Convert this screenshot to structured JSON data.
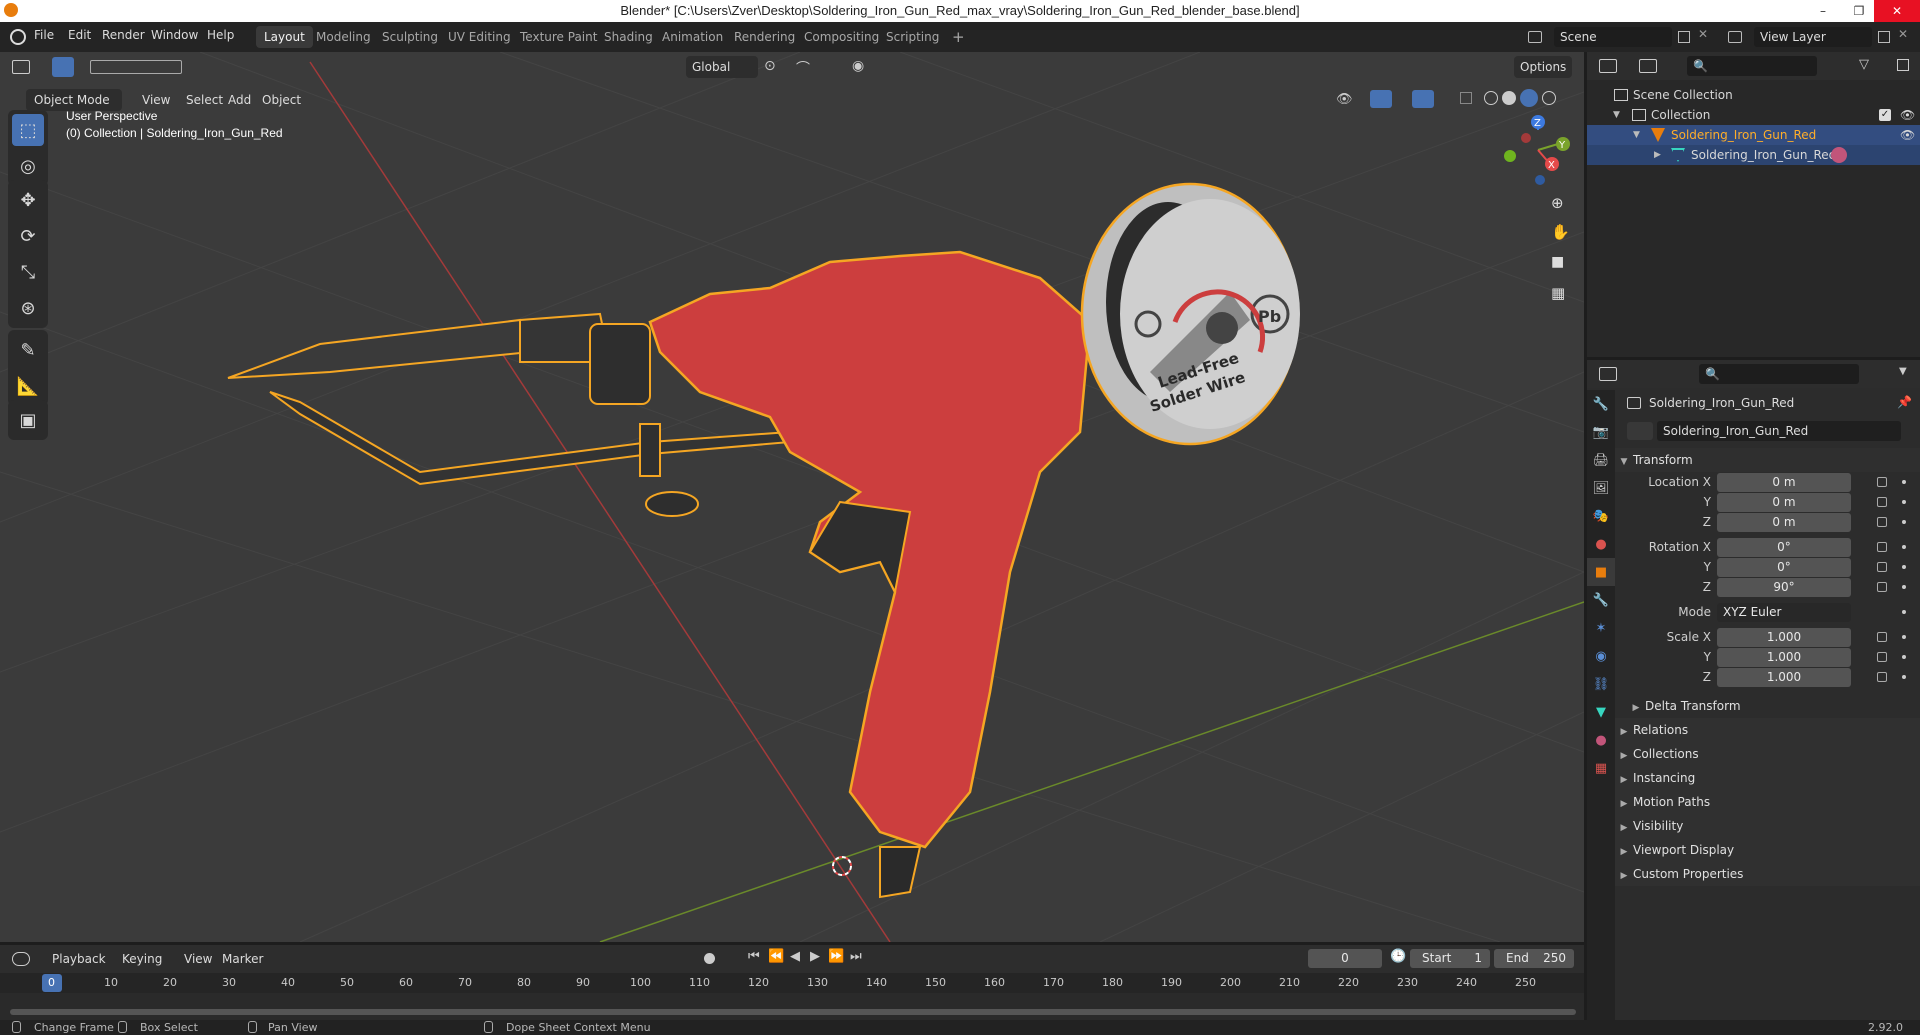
{
  "window": {
    "title": "Blender* [C:\\Users\\Zver\\Desktop\\Soldering_Iron_Gun_Red_max_vray\\Soldering_Iron_Gun_Red_blender_base.blend]",
    "minimize": "–",
    "restore": "❐",
    "close": "✕"
  },
  "menu": [
    "File",
    "Edit",
    "Render",
    "Window",
    "Help"
  ],
  "workspaces": [
    "Layout",
    "Modeling",
    "Sculpting",
    "UV Editing",
    "Texture Paint",
    "Shading",
    "Animation",
    "Rendering",
    "Compositing",
    "Scripting"
  ],
  "workspace_add": "+",
  "scene": {
    "name": "Scene",
    "view_layer": "View Layer"
  },
  "viewport": {
    "mode": "Object Mode",
    "menus": [
      "View",
      "Select",
      "Add",
      "Object"
    ],
    "transform_orientation": "Global",
    "options": "Options",
    "overlay_title": "User Perspective",
    "overlay_sub": "(0) Collection | Soldering_Iron_Gun_Red",
    "gizmo": {
      "x": "X",
      "y": "Y",
      "z": "Z"
    },
    "model_text": {
      "line1": "Lead-Free",
      "line2": "Solder Wire",
      "badge": "Pb"
    }
  },
  "outliner": {
    "root": "Scene Collection",
    "collection": "Collection",
    "object": "Soldering_Iron_Gun_Red",
    "mesh": "Soldering_Iron_Gun_Red"
  },
  "properties": {
    "object_name": "Soldering_Iron_Gun_Red",
    "object_field": "Soldering_Iron_Gun_Red",
    "transform_header": "Transform",
    "location_label": "Location X",
    "rotation_label": "Rotation X",
    "scale_label": "Scale X",
    "y_label": "Y",
    "z_label": "Z",
    "location": [
      "0 m",
      "0 m",
      "0 m"
    ],
    "rotation": [
      "0°",
      "0°",
      "90°"
    ],
    "mode_label": "Mode",
    "mode_value": "XYZ Euler",
    "scale": [
      "1.000",
      "1.000",
      "1.000"
    ],
    "delta": "Delta Transform",
    "sections": [
      "Relations",
      "Collections",
      "Instancing",
      "Motion Paths",
      "Visibility",
      "Viewport Display",
      "Custom Properties"
    ]
  },
  "timeline": {
    "menus": [
      "Playback",
      "Keying",
      "View",
      "Marker"
    ],
    "current_frame": "0",
    "start_label": "Start",
    "start": "1",
    "end_label": "End",
    "end": "250",
    "ticks": [
      "0",
      "10",
      "20",
      "30",
      "40",
      "50",
      "60",
      "70",
      "80",
      "90",
      "100",
      "110",
      "120",
      "130",
      "140",
      "150",
      "160",
      "170",
      "180",
      "190",
      "200",
      "210",
      "220",
      "230",
      "240",
      "250"
    ]
  },
  "status": {
    "change_frame": "Change Frame",
    "box_select": "Box Select",
    "pan_view": "Pan View",
    "context_menu": "Dope Sheet Context Menu",
    "version": "2.92.0"
  },
  "colors": {
    "accent": "#4772b3",
    "selection_outline": "#f5a623",
    "body_red": "#cc3e3e",
    "x_axis": "#e54a4a",
    "y_axis": "#7aa32b",
    "z_axis": "#3d7ae0"
  }
}
